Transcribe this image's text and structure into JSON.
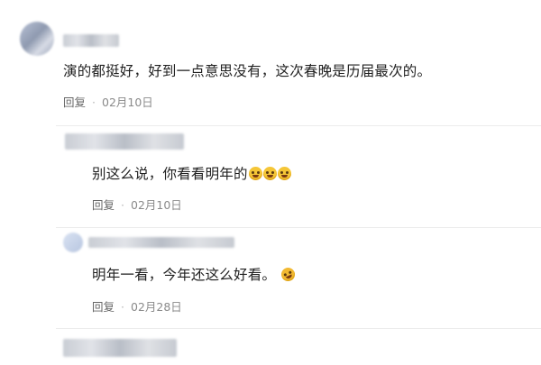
{
  "comments": [
    {
      "text": "演的都挺好，好到一点意思没有，这次春晚是历届最次的。",
      "reply_label": "回复",
      "separator": "·",
      "date": "02月10日"
    },
    {
      "text": "别这么说，你看看明年的",
      "emoji_count": 3,
      "reply_label": "回复",
      "separator": "·",
      "date": "02月10日"
    },
    {
      "text": "明年一看，今年还这么好看。",
      "emoji_count": 1,
      "reply_label": "回复",
      "separator": "·",
      "date": "02月28日"
    }
  ],
  "icons": {
    "emoji": "laughing-face-icon"
  }
}
